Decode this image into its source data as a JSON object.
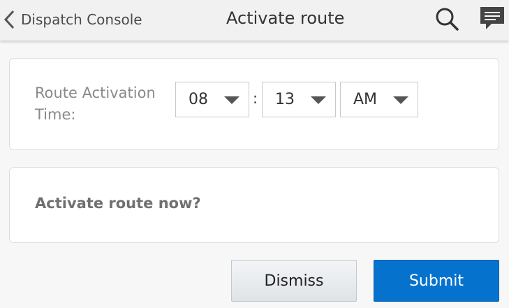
{
  "header": {
    "back_label": "Dispatch Console",
    "title": "Activate route",
    "icons": [
      "chevron-left-icon",
      "search-icon",
      "chat-icon"
    ]
  },
  "activation": {
    "label": "Route Activation Time:",
    "hour": "08",
    "separator": ":",
    "minute": "13",
    "ampm": "AM"
  },
  "confirm": {
    "question": "Activate route now?"
  },
  "buttons": {
    "dismiss": "Dismiss",
    "submit": "Submit"
  },
  "colors": {
    "primary": "#0572ce",
    "header_bg": "#f1f1f1",
    "page_bg": "#f7f7f7"
  }
}
